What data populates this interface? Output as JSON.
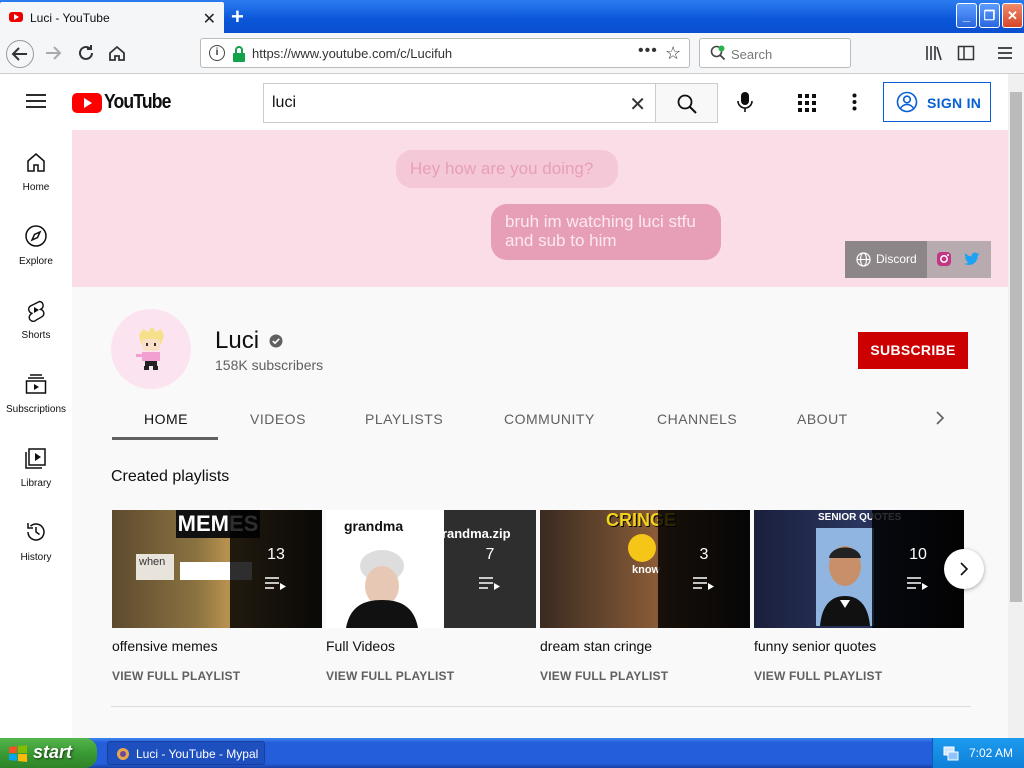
{
  "browser": {
    "tab_title": "Luci - YouTube",
    "url": "https://www.youtube.com/c/Lucifuh",
    "search_placeholder": "Search"
  },
  "youtube": {
    "logo_text": "YouTube",
    "search_value": "luci",
    "sign_in": "SIGN IN",
    "sidebar": [
      {
        "label": "Home"
      },
      {
        "label": "Explore"
      },
      {
        "label": "Shorts"
      },
      {
        "label": "Subscriptions"
      },
      {
        "label": "Library"
      },
      {
        "label": "History"
      }
    ],
    "banner": {
      "bubble1": "Hey how are you doing?",
      "bubble2": "bruh im watching luci stfu and sub to him",
      "discord": "Discord"
    },
    "channel": {
      "name": "Luci",
      "subscribers": "158K subscribers",
      "subscribe": "SUBSCRIBE",
      "tabs": [
        "HOME",
        "VIDEOS",
        "PLAYLISTS",
        "COMMUNITY",
        "CHANNELS",
        "ABOUT"
      ]
    },
    "section_title": "Created playlists",
    "playlists": [
      {
        "name": "offensive memes",
        "count": "13",
        "view": "VIEW FULL PLAYLIST",
        "thumb_text": "MEMES",
        "thumb_small": "when"
      },
      {
        "name": "Full Videos",
        "count": "7",
        "view": "VIEW FULL PLAYLIST",
        "thumb_text": "grandma",
        "thumb_small": "grandma.zip"
      },
      {
        "name": "dream stan cringe",
        "count": "3",
        "view": "VIEW FULL PLAYLIST",
        "thumb_text": "CRINGE",
        "thumb_small": "know"
      },
      {
        "name": "funny senior quotes",
        "count": "10",
        "view": "VIEW FULL PLAYLIST",
        "thumb_text": "SENIOR QUOTES",
        "thumb_small": ""
      }
    ]
  },
  "taskbar": {
    "start": "start",
    "task_item": "Luci - YouTube - Mypal",
    "clock": "7:02 AM"
  }
}
